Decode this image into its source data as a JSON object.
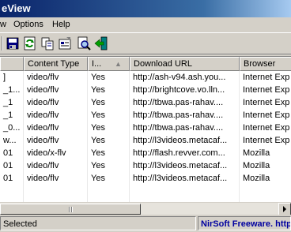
{
  "window": {
    "title": "eView"
  },
  "menu": {
    "view": "w",
    "options": "Options",
    "help": "Help"
  },
  "toolbar": {
    "buttons": [
      "save-icon",
      "refresh-icon",
      "copy-icon",
      "properties-icon",
      "find-icon",
      "exit-icon"
    ]
  },
  "table": {
    "columns": [
      "",
      "Content Type",
      "I...",
      "Download URL",
      "Browser"
    ],
    "sort_indicator": "▲",
    "rows": [
      [
        "]",
        "video/flv",
        "Yes",
        "http://ash-v94.ash.you...",
        "Internet Exp"
      ],
      [
        "_1...",
        "video/flv",
        "Yes",
        "http://brightcove.vo.lln...",
        "Internet Exp"
      ],
      [
        "_1",
        "video/flv",
        "Yes",
        "http://tbwa.pas-rahav....",
        "Internet Exp"
      ],
      [
        "_1",
        "video/flv",
        "Yes",
        "http://tbwa.pas-rahav....",
        "Internet Exp"
      ],
      [
        "_0...",
        "video/flv",
        "Yes",
        "http://tbwa.pas-rahav....",
        "Internet Exp"
      ],
      [
        "w...",
        "video/flv",
        "Yes",
        "http://l3videos.metacaf...",
        "Internet Exp"
      ],
      [
        "01",
        "video/x-flv",
        "Yes",
        "http://flash.revver.com...",
        "Mozilla"
      ],
      [
        "01",
        "video/flv",
        "Yes",
        "http://l3videos.metacaf...",
        "Mozilla"
      ],
      [
        "01",
        "video/flv",
        "Yes",
        "http://l3videos.metacaf...",
        "Mozilla"
      ]
    ]
  },
  "status": {
    "selected": " Selected",
    "credit": "NirSoft Freeware.  http://w",
    "credit_color": "#0000a0"
  }
}
